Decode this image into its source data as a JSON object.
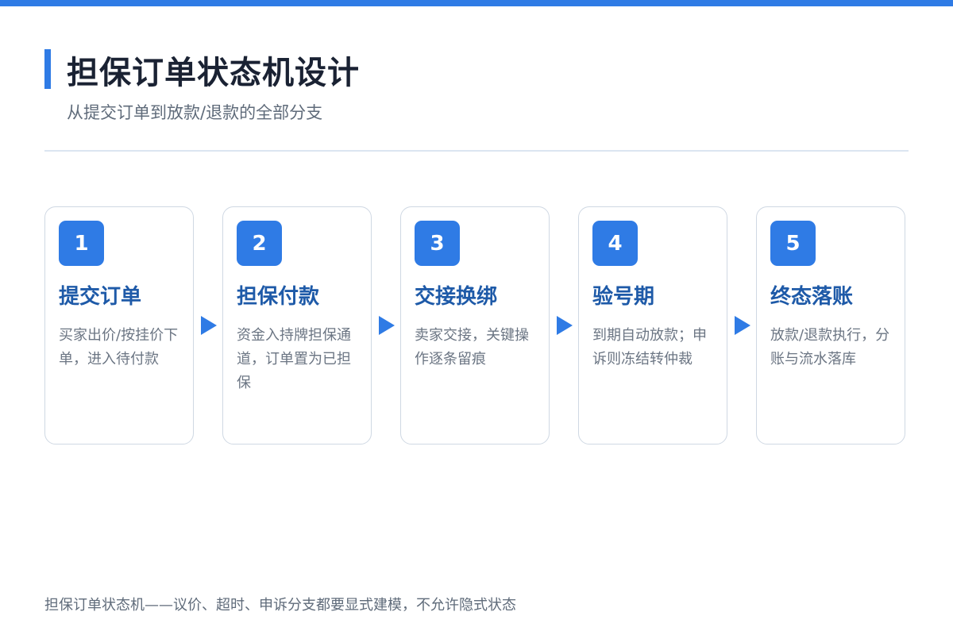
{
  "header": {
    "title": "担保订单状态机设计",
    "subtitle": "从提交订单到放款/退款的全部分支"
  },
  "steps": [
    {
      "number": "1",
      "title": "提交订单",
      "desc": "买家出价/按挂价下单，进入待付款"
    },
    {
      "number": "2",
      "title": "担保付款",
      "desc": "资金入持牌担保通道，订单置为已担保"
    },
    {
      "number": "3",
      "title": "交接换绑",
      "desc": "卖家交接，关键操作逐条留痕"
    },
    {
      "number": "4",
      "title": "验号期",
      "desc": "到期自动放款；申诉则冻结转仲裁"
    },
    {
      "number": "5",
      "title": "终态落账",
      "desc": "放款/退款执行，分账与流水落库"
    }
  ],
  "footer": {
    "note": "担保订单状态机——议价、超时、申诉分支都要显式建模，不允许隐式状态"
  },
  "colors": {
    "accent": "#2f7be5",
    "step_title": "#1e5aa8",
    "card_border": "#cfd8e3"
  }
}
